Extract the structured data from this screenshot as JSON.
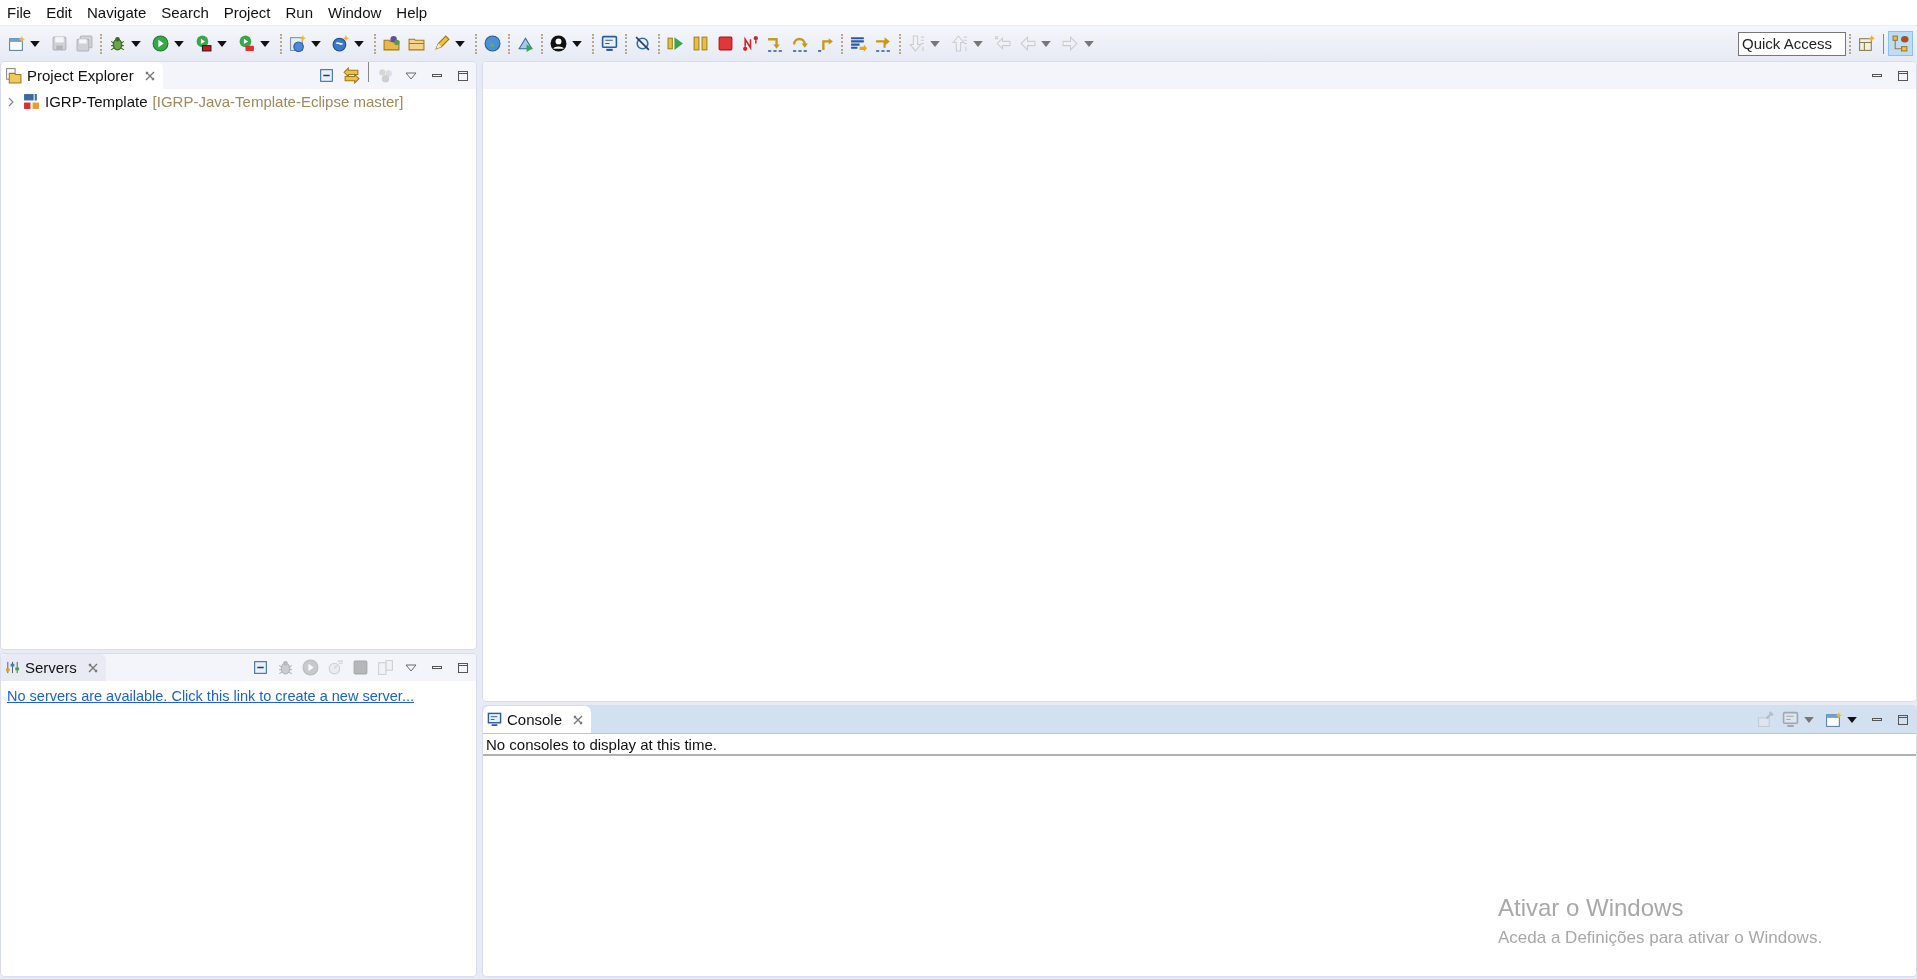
{
  "menu": [
    "File",
    "Edit",
    "Navigate",
    "Search",
    "Project",
    "Run",
    "Window",
    "Help"
  ],
  "toolbar": [
    {
      "kind": "new-window",
      "dropdown": true,
      "disabled": false
    },
    {
      "kind": "save",
      "dropdown": false,
      "disabled": true
    },
    {
      "kind": "save-all",
      "dropdown": false,
      "disabled": true
    },
    {
      "kind": "separator"
    },
    {
      "kind": "bug",
      "dropdown": true,
      "disabled": false
    },
    {
      "kind": "run",
      "dropdown": true,
      "disabled": false
    },
    {
      "kind": "coverage",
      "dropdown": true,
      "disabled": false
    },
    {
      "kind": "external",
      "dropdown": true,
      "disabled": false
    },
    {
      "kind": "separator"
    },
    {
      "kind": "new-server",
      "dropdown": true,
      "disabled": false
    },
    {
      "kind": "new-service",
      "dropdown": true,
      "disabled": false
    },
    {
      "kind": "separator"
    },
    {
      "kind": "folder-ball",
      "dropdown": false,
      "disabled": false
    },
    {
      "kind": "folder",
      "dropdown": false,
      "disabled": false
    },
    {
      "kind": "pencil",
      "dropdown": true,
      "disabled": false
    },
    {
      "kind": "separator"
    },
    {
      "kind": "globe",
      "dropdown": false,
      "disabled": false
    },
    {
      "kind": "separator"
    },
    {
      "kind": "deploy",
      "dropdown": false,
      "disabled": false
    },
    {
      "kind": "separator"
    },
    {
      "kind": "person",
      "dropdown": true,
      "disabled": false
    },
    {
      "kind": "separator"
    },
    {
      "kind": "monitor",
      "dropdown": false,
      "disabled": false
    },
    {
      "kind": "separator"
    },
    {
      "kind": "skip",
      "dropdown": false,
      "disabled": false
    },
    {
      "kind": "separator"
    },
    {
      "kind": "resume",
      "dropdown": false,
      "disabled": false
    },
    {
      "kind": "suspend",
      "dropdown": false,
      "disabled": false
    },
    {
      "kind": "terminate",
      "dropdown": false,
      "disabled": false
    },
    {
      "kind": "disconnect",
      "dropdown": false,
      "disabled": false
    },
    {
      "kind": "step-into",
      "dropdown": false,
      "disabled": false
    },
    {
      "kind": "step-over",
      "dropdown": false,
      "disabled": false
    },
    {
      "kind": "step-return",
      "dropdown": false,
      "disabled": false
    },
    {
      "kind": "separator"
    },
    {
      "kind": "drop-frame",
      "dropdown": false,
      "disabled": false
    },
    {
      "kind": "step-filters",
      "dropdown": false,
      "disabled": false
    },
    {
      "kind": "separator"
    },
    {
      "kind": "arrow-down",
      "dropdown": true,
      "disabled": true
    },
    {
      "kind": "arrow-up",
      "dropdown": true,
      "disabled": true
    },
    {
      "kind": "arrow-left-star",
      "dropdown": false,
      "disabled": true
    },
    {
      "kind": "arrow-left",
      "dropdown": true,
      "disabled": true
    },
    {
      "kind": "arrow-right",
      "dropdown": true,
      "disabled": true
    }
  ],
  "quick_access": {
    "placeholder": "Quick Access"
  },
  "perspectives": [
    {
      "kind": "table-plus",
      "selected": false
    },
    {
      "kind": "nodes",
      "selected": true
    }
  ],
  "project_explorer": {
    "tab": {
      "label": "Project Explorer",
      "selected": true
    },
    "tools": [
      {
        "kind": "collapse",
        "disabled": false
      },
      {
        "kind": "link",
        "disabled": false
      },
      {
        "kind": "separator"
      },
      {
        "kind": "balls",
        "disabled": true
      }
    ],
    "tree": [
      {
        "label": "IGRP-Template",
        "decoration": "[IGRP-Java-Template-Eclipse master]",
        "expanded": false
      }
    ]
  },
  "servers": {
    "tab": {
      "label": "Servers",
      "selected": false
    },
    "tools": [
      {
        "kind": "collapse",
        "disabled": false
      },
      {
        "kind": "bug",
        "disabled": true
      },
      {
        "kind": "run",
        "disabled": true
      },
      {
        "kind": "profile",
        "disabled": true
      },
      {
        "kind": "terminate",
        "disabled": true
      },
      {
        "kind": "publish",
        "disabled": true
      }
    ],
    "link": "No servers are available. Click this link to create a new server..."
  },
  "console": {
    "tab": {
      "label": "Console",
      "selected": true
    },
    "tools": [
      {
        "kind": "pin",
        "dropdown": false,
        "disabled": true
      },
      {
        "kind": "monitor",
        "dropdown": true,
        "disabled": true
      },
      {
        "kind": "new-window",
        "dropdown": true,
        "disabled": false
      }
    ],
    "message": "No consoles to display at this time."
  },
  "activation_notice": {
    "title": "Ativar o Windows",
    "subtitle": "Aceda a Definições para ativar o Windows."
  }
}
